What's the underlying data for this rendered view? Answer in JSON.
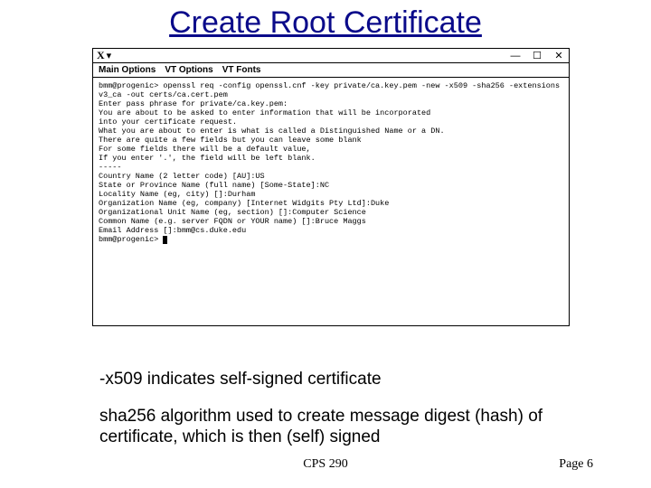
{
  "slide": {
    "title": "Create Root Certificate",
    "course": "CPS 290",
    "page_label": "Page 6"
  },
  "terminal": {
    "logo": "X",
    "logo_arrow": "▾",
    "menubar": [
      "Main Options",
      "VT Options",
      "VT Fonts"
    ],
    "winctl_min": "—",
    "winctl_max": "☐",
    "winctl_close": "✕",
    "line1": "bmm@progenic> openssl req -config openssl.cnf -key private/ca.key.pem -new -x509 -sha256 -extensions v3_ca -out certs/ca.cert.pem",
    "line2": "Enter pass phrase for private/ca.key.pem:",
    "line3": "You are about to be asked to enter information that will be incorporated",
    "line4": "into your certificate request.",
    "line5": "What you are about to enter is what is called a Distinguished Name or a DN.",
    "line6": "There are quite a few fields but you can leave some blank",
    "line7": "For some fields there will be a default value,",
    "line8": "If you enter '.', the field will be left blank.",
    "line9": "-----",
    "line10": "Country Name (2 letter code) [AU]:US",
    "line11": "State or Province Name (full name) [Some-State]:NC",
    "line12": "Locality Name (eg, city) []:Durham",
    "line13": "Organization Name (eg, company) [Internet Widgits Pty Ltd]:Duke",
    "line14": "Organizational Unit Name (eg, section) []:Computer Science",
    "line15": "Common Name (e.g. server FQDN or YOUR name) []:Bruce Maggs",
    "line16": "Email Address []:bmm@cs.duke.edu",
    "line17": "bmm@progenic>"
  },
  "notes": {
    "n1": "-x509 indicates self-signed certificate",
    "n2": "sha256 algorithm used to create message digest (hash) of certificate, which is then (self) signed"
  }
}
